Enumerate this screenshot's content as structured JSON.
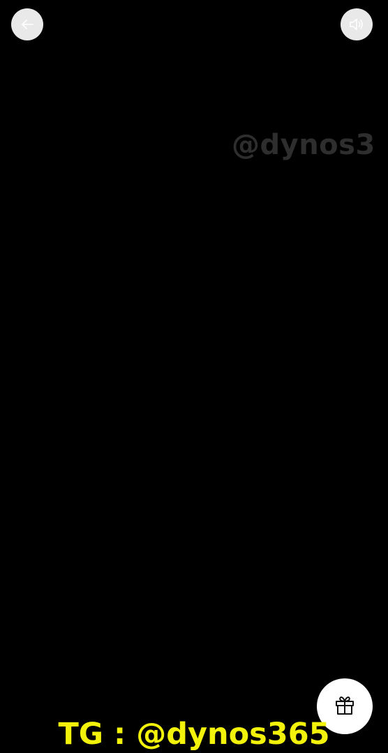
{
  "controls": {
    "back_icon": "arrow-left-icon",
    "sound_icon": "speaker-icon",
    "gift_icon": "gift-icon"
  },
  "watermark": {
    "text": "@dynos3"
  },
  "caption": {
    "text": "TG : @dynos365"
  },
  "colors": {
    "background": "#000000",
    "button_bg": "#e9e9e9",
    "caption": "#f2f20a",
    "watermark": "#2e2e2e"
  }
}
